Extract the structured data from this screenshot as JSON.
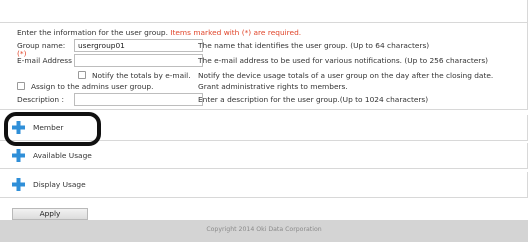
{
  "intro": {
    "text": "Enter the information for the user group. ",
    "required_note": "Items marked with (*) are required."
  },
  "fields": {
    "group_name": {
      "label": "Group name:",
      "required_mark": "(*)",
      "value": "usergroup01",
      "description": "The name that identifies the user group. (Up to 64 characters)"
    },
    "email": {
      "label": "E-mail Address :",
      "value": "",
      "description": "The e-mail address to be used for various notifications. (Up to 256 characters)"
    },
    "notify": {
      "label": "Notify the totals by e-mail.",
      "description": "Notify the device usage totals of a user group on the day after the closing date."
    },
    "admin": {
      "label": "Assign to the admins user group.",
      "description": "Grant administrative rights to members."
    },
    "description": {
      "label": "Description :",
      "value": "",
      "description": "Enter a description for the user group.(Up to 1024 characters)"
    }
  },
  "sections": [
    {
      "title": "Member"
    },
    {
      "title": "Available Usage"
    },
    {
      "title": "Display Usage"
    }
  ],
  "actions": {
    "apply_label": "Apply"
  },
  "footer": {
    "copyright": "Copyright 2014 Oki Data Corporation"
  },
  "colors": {
    "required": "#e0452a",
    "plus_icon": "#2f8fd8",
    "footer_bg": "#d4d4d4"
  }
}
